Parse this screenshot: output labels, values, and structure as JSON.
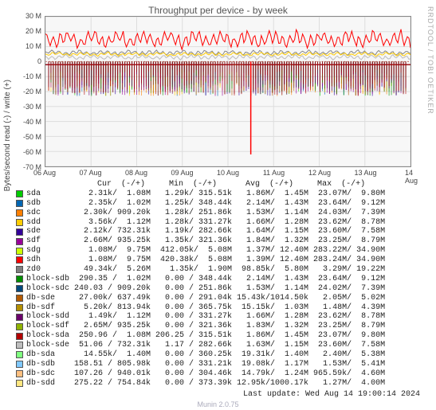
{
  "title": "Throughput per device - by week",
  "ylabel": "Bytes/second read (-) / write (+)",
  "footer": "Munin 2.0.75",
  "watermark": "RRDTOOL / TOBI OETIKER",
  "last_update": "Last update: Wed Aug 14 19:00:14 2024",
  "chart_data": {
    "type": "line",
    "xlabel": "",
    "ylim": [
      -70,
      30
    ],
    "yticks": [
      -70,
      -60,
      -50,
      -40,
      -30,
      -20,
      -10,
      0,
      10,
      20,
      30
    ],
    "ytick_labels": [
      "-70 M",
      "-60 M",
      "-50 M",
      "-40 M",
      "-30 M",
      "-20 M",
      "-10 M",
      "0",
      "10 M",
      "20 M",
      "30 M"
    ],
    "categories": [
      "06 Aug",
      "07 Aug",
      "08 Aug",
      "09 Aug",
      "10 Aug",
      "11 Aug",
      "12 Aug",
      "13 Aug",
      "14 Aug"
    ],
    "legend_header": "                 Cur  (-/+)     Min  (-/+)      Avg  (-/+)     Max  (-/+)",
    "series": [
      {
        "name": "sda",
        "color": "#00cc00",
        "cur": "2.31k/  1.08M",
        "min": "1.29k/ 315.51k",
        "avg": "1.86M/  1.45M",
        "max": "23.07M/  9.80M"
      },
      {
        "name": "sdb",
        "color": "#0066b3",
        "cur": "2.35k/  1.02M",
        "min": "1.25k/ 348.44k",
        "avg": "2.14M/  1.43M",
        "max": "23.64M/  9.12M"
      },
      {
        "name": "sdc",
        "color": "#ff8000",
        "cur": "2.30k/ 909.20k",
        "min": "1.28k/ 251.86k",
        "avg": "1.53M/  1.14M",
        "max": "24.03M/  7.39M"
      },
      {
        "name": "sdd",
        "color": "#ffcc00",
        "cur": "3.56k/  1.12M",
        "min": "1.28k/ 331.27k",
        "avg": "1.66M/  1.28M",
        "max": "23.62M/  8.78M"
      },
      {
        "name": "sde",
        "color": "#330099",
        "cur": "2.12k/ 732.31k",
        "min": "1.19k/ 282.66k",
        "avg": "1.64M/  1.15M",
        "max": "23.60M/  7.58M"
      },
      {
        "name": "sdf",
        "color": "#990099",
        "cur": "2.66M/ 935.25k",
        "min": "1.35k/ 321.36k",
        "avg": "1.84M/  1.32M",
        "max": "23.25M/  8.79M"
      },
      {
        "name": "sdg",
        "color": "#ccff00",
        "cur": "1.08M/  9.75M",
        "min": "412.05k/  5.08M",
        "avg": "1.37M/ 12.40M",
        "max": "283.22M/ 34.90M"
      },
      {
        "name": "sdh",
        "color": "#ff0000",
        "cur": "1.08M/  9.75M",
        "min": "420.38k/  5.08M",
        "avg": "1.39M/ 12.40M",
        "max": "283.24M/ 34.90M"
      },
      {
        "name": "zd0",
        "color": "#808080",
        "cur": "49.34k/  5.26M",
        "min": "1.35k/  1.90M",
        "avg": "98.85k/  5.80M",
        "max": "3.29M/ 19.22M"
      },
      {
        "name": "block-sdb",
        "color": "#008f00",
        "cur": "290.35 /  1.02M",
        "min": "0.00 / 348.44k",
        "avg": "2.14M/  1.43M",
        "max": "23.64M/  9.12M"
      },
      {
        "name": "block-sdc",
        "color": "#00487d",
        "cur": "240.03 / 909.20k",
        "min": "0.00 / 251.86k",
        "avg": "1.53M/  1.14M",
        "max": "24.02M/  7.39M"
      },
      {
        "name": "db-sde",
        "color": "#b35a00",
        "cur": "27.00k/ 637.49k",
        "min": "0.00 / 291.04k",
        "avg": "15.43k/1014.50k",
        "max": "2.05M/  5.02M"
      },
      {
        "name": "db-sdf",
        "color": "#b38f00",
        "cur": "5.20k/ 813.94k",
        "min": "0.00 / 365.75k",
        "avg": "15.15k/  1.03M",
        "max": "1.48M/  4.39M"
      },
      {
        "name": "block-sdd",
        "color": "#6b006b",
        "cur": "1.49k/  1.12M",
        "min": "0.00 / 331.27k",
        "avg": "1.66M/  1.28M",
        "max": "23.62M/  8.78M"
      },
      {
        "name": "block-sdf",
        "color": "#8fb300",
        "cur": "2.65M/ 935.25k",
        "min": "0.00 / 321.36k",
        "avg": "1.83M/  1.32M",
        "max": "23.25M/  8.79M"
      },
      {
        "name": "block-sda",
        "color": "#b30000",
        "cur": "250.96 /  1.08M",
        "min": "206.25 / 315.51k",
        "avg": "1.86M/  1.45M",
        "max": "23.07M/  9.80M"
      },
      {
        "name": "block-sde",
        "color": "#bebebe",
        "cur": "51.06 / 732.31k",
        "min": "1.17 / 282.66k",
        "avg": "1.63M/  1.15M",
        "max": "23.60M/  7.58M"
      },
      {
        "name": "db-sda",
        "color": "#80ff80",
        "cur": "14.55k/  1.40M",
        "min": "0.00 / 360.25k",
        "avg": "19.31k/  1.40M",
        "max": "2.40M/  5.38M"
      },
      {
        "name": "db-sdb",
        "color": "#80c9ff",
        "cur": "158.51 / 805.98k",
        "min": "0.00 / 331.21k",
        "avg": "19.08k/  1.17M",
        "max": "1.53M/  5.41M"
      },
      {
        "name": "db-sdc",
        "color": "#ffc080",
        "cur": "107.26 / 940.01k",
        "min": "0.00 / 304.46k",
        "avg": "14.79k/  1.24M",
        "max": "965.59k/  4.60M"
      },
      {
        "name": "db-sdd",
        "color": "#ffe680",
        "cur": "275.22 / 754.84k",
        "min": "0.00 / 373.39k",
        "avg": "12.95k/1000.17k",
        "max": "1.27M/  4.00M"
      }
    ]
  }
}
